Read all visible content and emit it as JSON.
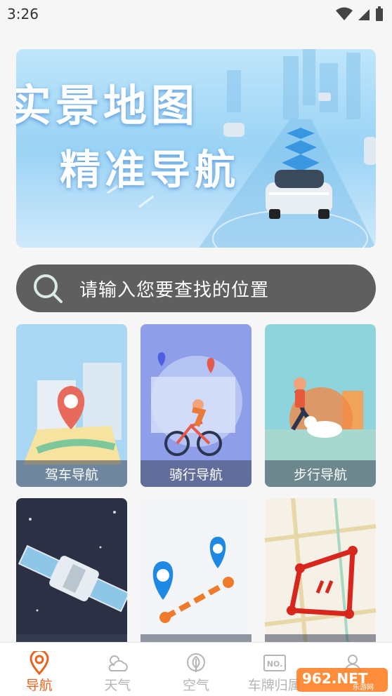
{
  "status": {
    "time": "3:26"
  },
  "banner": {
    "line1": "实景地图",
    "line2": "精准导航"
  },
  "search": {
    "placeholder": "请输入您要查找的位置"
  },
  "cards": [
    {
      "label": "驾车导航"
    },
    {
      "label": "骑行导航"
    },
    {
      "label": "步行导航"
    },
    {
      "label": ""
    },
    {
      "label": ""
    },
    {
      "label": ""
    }
  ],
  "nav": {
    "items": [
      {
        "label": "导航",
        "icon": "location-pin-icon",
        "active": true
      },
      {
        "label": "天气",
        "icon": "weather-icon",
        "active": false
      },
      {
        "label": "空气",
        "icon": "leaf-icon",
        "active": false
      },
      {
        "label": "车牌归属",
        "icon": "license-plate-icon",
        "active": false
      },
      {
        "label": "",
        "icon": "profile-icon",
        "active": false
      }
    ]
  },
  "watermark": {
    "text": "962.NET",
    "sub": "乐游网"
  },
  "colors": {
    "accent": "#e8641e",
    "search_bg": "#5f5f5f"
  }
}
